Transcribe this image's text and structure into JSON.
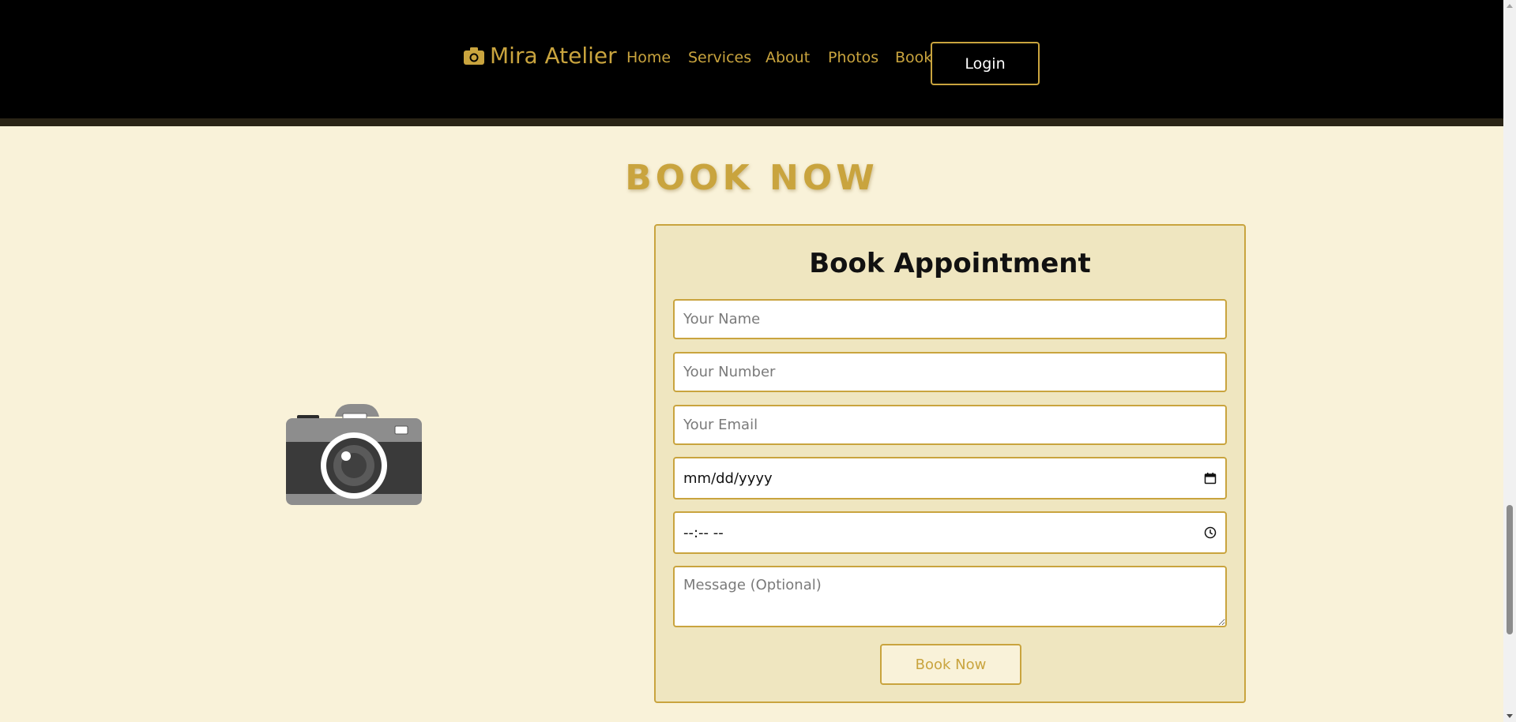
{
  "header": {
    "brand": "Mira Atelier",
    "brand_icon": "camera-icon",
    "nav": [
      "Home",
      "Services",
      "About",
      "Photos",
      "Book"
    ],
    "login_label": "Login"
  },
  "section": {
    "title": "BOOK NOW",
    "illustration": "camera-illustration"
  },
  "form": {
    "heading": "Book Appointment",
    "name_placeholder": "Your Name",
    "number_placeholder": "Your Number",
    "email_placeholder": "Your Email",
    "date_value": "mm/dd/yyyy",
    "time_value": "--:-- --",
    "message_placeholder": "Message (Optional)",
    "submit_label": "Book Now"
  },
  "colors": {
    "accent": "#c9a43e",
    "header_bg": "#000000",
    "page_bg": "#f9f2d9",
    "card_bg": "#efe6c0"
  }
}
